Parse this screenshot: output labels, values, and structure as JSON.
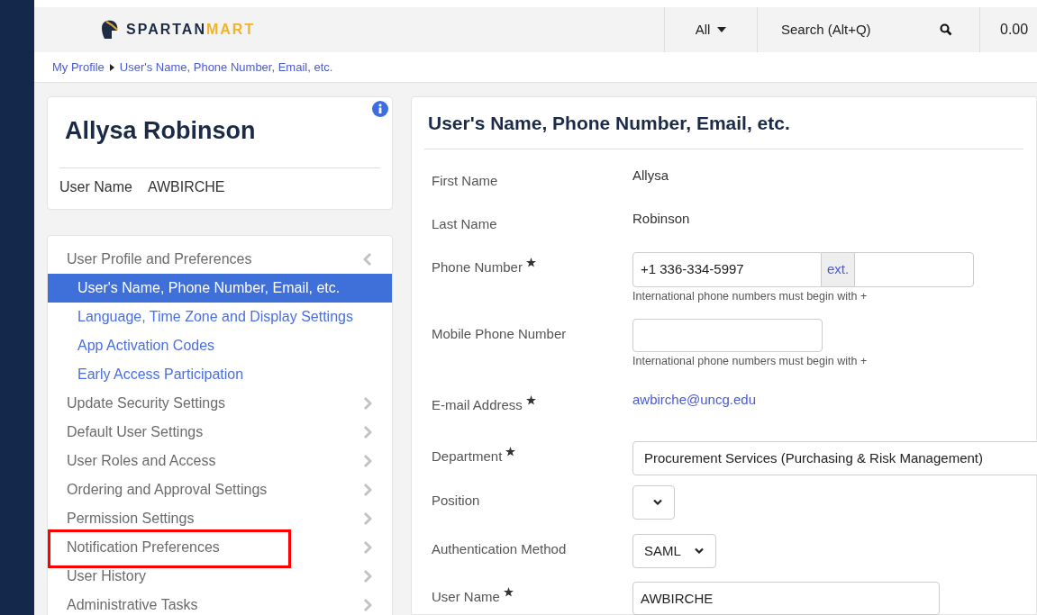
{
  "header": {
    "logo": {
      "first": "SPARTAN",
      "second": "MART"
    },
    "scope": "All",
    "search": {
      "placeholder": "Search (Alt+Q)"
    },
    "cart_total": "0.00"
  },
  "breadcrumb": [
    "My Profile",
    "User's Name, Phone Number, Email, etc."
  ],
  "profile": {
    "name": "Allysa Robinson",
    "username_label": "User Name",
    "username": "AWBIRCHE"
  },
  "nav": [
    {
      "label": "User Profile and Preferences",
      "expanded": true,
      "highlighted": false,
      "children": [
        {
          "label": "User's Name, Phone Number, Email, etc.",
          "selected": true
        },
        {
          "label": "Language, Time Zone and Display Settings",
          "selected": false
        },
        {
          "label": "App Activation Codes",
          "selected": false
        },
        {
          "label": "Early Access Participation",
          "selected": false
        }
      ]
    },
    {
      "label": "Update Security Settings",
      "expanded": false,
      "highlighted": false
    },
    {
      "label": "Default User Settings",
      "expanded": false,
      "highlighted": false
    },
    {
      "label": "User Roles and Access",
      "expanded": false,
      "highlighted": false
    },
    {
      "label": "Ordering and Approval Settings",
      "expanded": false,
      "highlighted": false
    },
    {
      "label": "Permission Settings",
      "expanded": false,
      "highlighted": false
    },
    {
      "label": "Notification Preferences",
      "expanded": false,
      "highlighted": true
    },
    {
      "label": "User History",
      "expanded": false,
      "highlighted": false
    },
    {
      "label": "Administrative Tasks",
      "expanded": false,
      "highlighted": false
    }
  ],
  "form": {
    "title": "User's Name, Phone Number, Email, etc.",
    "fields": [
      {
        "kind": "text",
        "label": "First Name",
        "required": false,
        "value": "Allysa"
      },
      {
        "kind": "text",
        "label": "Last Name",
        "required": false,
        "value": "Robinson"
      },
      {
        "kind": "phone",
        "label": "Phone Number",
        "required": true,
        "value": "+1 336-334-5997",
        "ext_label": "ext.",
        "help": "International phone numbers must begin with +"
      },
      {
        "kind": "input",
        "label": "Mobile Phone Number",
        "required": false,
        "help": "International phone numbers must begin with +"
      },
      {
        "kind": "link",
        "label": "E-mail Address",
        "required": true,
        "value": "awbirche@uncg.edu"
      },
      {
        "kind": "select",
        "label": "Department",
        "required": true,
        "value": "Procurement Services (Purchasing & Risk Management)"
      },
      {
        "kind": "select",
        "label": "Position",
        "required": false
      },
      {
        "kind": "select",
        "label": "Authentication Method",
        "required": false,
        "value": "SAML"
      },
      {
        "kind": "input",
        "label": "User Name",
        "required": true,
        "value": "AWBIRCHE"
      }
    ]
  }
}
